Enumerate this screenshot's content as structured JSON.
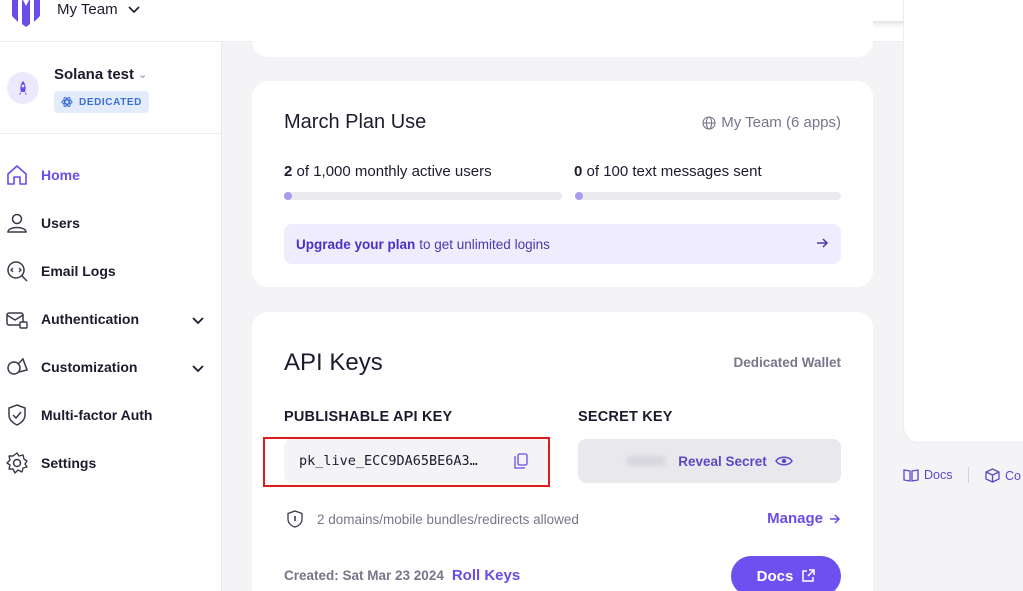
{
  "colors": {
    "accent": "#6b4ce6",
    "button": "#6e50f0",
    "highlight": "#e01b1b",
    "badge_bg": "#e3ecfb",
    "badge_text": "#3d6fd8"
  },
  "header": {
    "team_name": "My Team"
  },
  "sidebar": {
    "app_name": "Solana test",
    "badge": "DEDICATED",
    "items": [
      {
        "label": "Home",
        "icon": "home-icon",
        "active": true
      },
      {
        "label": "Users",
        "icon": "user-icon"
      },
      {
        "label": "Email Logs",
        "icon": "email-search-icon"
      },
      {
        "label": "Authentication",
        "icon": "mail-lock-icon",
        "expandable": true
      },
      {
        "label": "Customization",
        "icon": "shapes-icon",
        "expandable": true
      },
      {
        "label": "Multi-factor Auth",
        "icon": "shield-check-icon"
      },
      {
        "label": "Settings",
        "icon": "gear-icon"
      }
    ]
  },
  "plan": {
    "title": "March Plan Use",
    "scope": "My Team (6 apps)",
    "users_count": "2",
    "users_text": " of 1,000 monthly active users",
    "users_progress": 0.002,
    "sms_count": "0",
    "sms_text": " of 100 text messages sent",
    "sms_progress": 0,
    "upgrade_bold": "Upgrade your plan",
    "upgrade_text": "to get unlimited logins"
  },
  "api": {
    "title": "API Keys",
    "wallet_type": "Dedicated Wallet",
    "publishable_label": "PUBLISHABLE API KEY",
    "publishable_value": "pk_live_ECC9DA65BE6A3…",
    "secret_label": "SECRET KEY",
    "reveal_label": "Reveal Secret",
    "domains_text": "2 domains/mobile bundles/redirects allowed",
    "manage_label": "Manage",
    "created_text": "Created: Sat Mar 23 2024",
    "roll_label": "Roll Keys",
    "docs_label": "Docs"
  },
  "right_panel": {
    "docs_label": "Docs",
    "code_label": "Co"
  }
}
